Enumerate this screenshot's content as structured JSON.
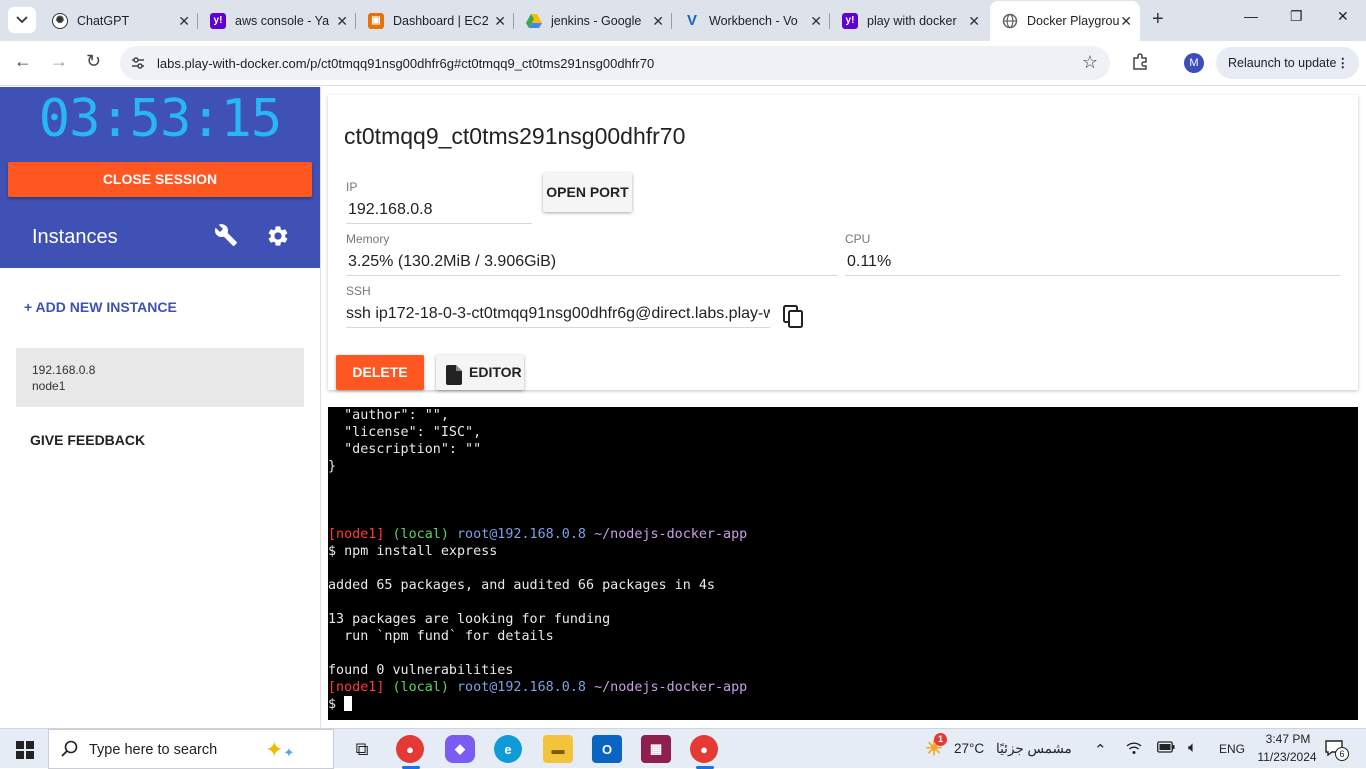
{
  "browser": {
    "tabs": [
      {
        "title": "ChatGPT",
        "icon": "chatgpt-icon",
        "color": "#333333"
      },
      {
        "title": "aws console - Ya",
        "icon": "yahoo-icon",
        "color": "#6001d2"
      },
      {
        "title": "Dashboard | EC2",
        "icon": "aws-icon",
        "color": "#e8710a"
      },
      {
        "title": "jenkins - Google",
        "icon": "google-drive-icon",
        "color": "#34a853"
      },
      {
        "title": "Workbench - Vo",
        "icon": "vocareum-icon",
        "color": "#1565c0"
      },
      {
        "title": "play with docker",
        "icon": "yahoo-icon",
        "color": "#6001d2"
      },
      {
        "title": "Docker Playgrou",
        "icon": "globe-icon",
        "color": "#5f6368"
      }
    ],
    "url": "labs.play-with-docker.com/p/ct0tmqq91nsg00dhfr6g#ct0tmqq9_ct0tms291nsg00dhfr70",
    "profile_initial": "M",
    "relaunch_label": "Relaunch to update"
  },
  "sidebar": {
    "timer": "03:53:15",
    "close_session_label": "CLOSE SESSION",
    "instances_title": "Instances",
    "add_instance_label": "+ ADD NEW INSTANCE",
    "instances": [
      {
        "ip": "192.168.0.8",
        "name": "node1"
      }
    ],
    "feedback_label": "GIVE FEEDBACK"
  },
  "instance_panel": {
    "hostname": "ct0tmqq9_ct0tms291nsg00dhfr70",
    "ip_label": "IP",
    "ip_value": "192.168.0.8",
    "open_port_label": "OPEN PORT",
    "memory_label": "Memory",
    "memory_value": "3.25% (130.2MiB / 3.906GiB)",
    "cpu_label": "CPU",
    "cpu_value": "0.11%",
    "ssh_label": "SSH",
    "ssh_value": "ssh ip172-18-0-3-ct0tmqq91nsg00dhfr6g@direct.labs.play-w",
    "delete_label": "DELETE",
    "editor_label": "EDITOR"
  },
  "terminal": {
    "json_lines": [
      "  \"author\": \"\",",
      "  \"license\": \"ISC\",",
      "  \"description\": \"\"",
      "}"
    ],
    "prompt_node": "[node1]",
    "prompt_local": "(local)",
    "prompt_user": "root@192.168.0.8",
    "prompt_path": "~/nodejs-docker-app",
    "command": "$ npm install express",
    "output_added": "added 65 packages, and audited 66 packages in 4s",
    "output_funding_1": "13 packages are looking for funding",
    "output_funding_2": "  run `npm fund` for details",
    "output_found": "found 0 vulnerabilities",
    "prompt_dollar": "$ "
  },
  "taskbar": {
    "search_placeholder": "Type here to search",
    "weather_temp": "27°C",
    "weather_desc": "مشمس جزئيًا",
    "weather_badge": "1",
    "language": "ENG",
    "time": "3:47 PM",
    "date": "11/23/2024",
    "notification_count": "6"
  }
}
